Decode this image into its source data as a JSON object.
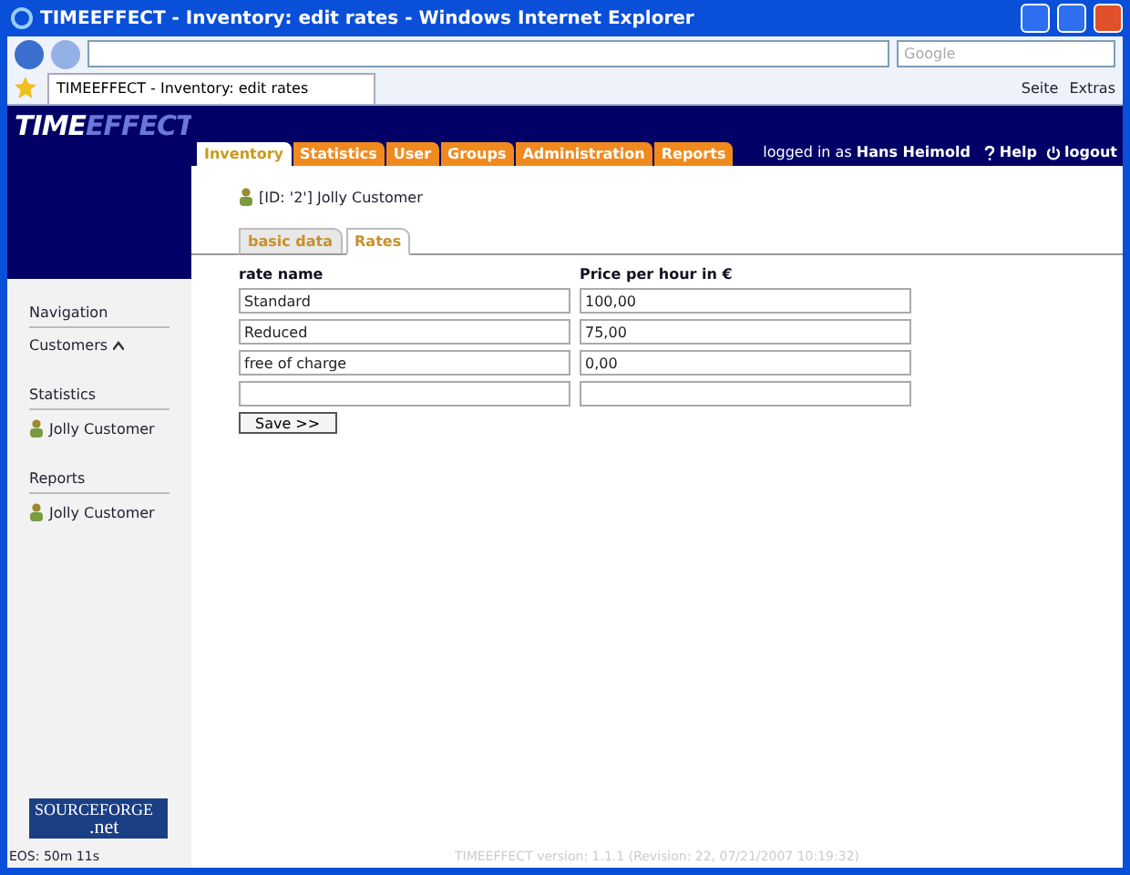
{
  "window": {
    "title": "TIMEEFFECT - Inventory: edit rates - Windows Internet Explorer"
  },
  "browser": {
    "search_placeholder": "Google",
    "tab_title": "TIMEEFFECT - Inventory: edit rates",
    "tools": [
      "Seite",
      "Extras"
    ]
  },
  "logo": {
    "first": "TIME",
    "second": "EFFECT"
  },
  "tabs": [
    {
      "label": "Inventory",
      "selected": true
    },
    {
      "label": "Statistics",
      "selected": false
    },
    {
      "label": "User",
      "selected": false
    },
    {
      "label": "Groups",
      "selected": false
    },
    {
      "label": "Administration",
      "selected": false
    },
    {
      "label": "Reports",
      "selected": false
    }
  ],
  "user": {
    "prefix": "logged in as",
    "name": "Hans Heimold"
  },
  "links": [
    "Help",
    "logout"
  ],
  "sidebar": [
    {
      "heading": "Navigation",
      "items": [
        {
          "label": "Customers",
          "kind": "nav"
        }
      ]
    },
    {
      "heading": "Statistics",
      "items": [
        {
          "label": "Jolly Customer",
          "kind": "customer"
        }
      ]
    },
    {
      "heading": "Reports",
      "items": [
        {
          "label": "Jolly Customer",
          "kind": "customer"
        }
      ]
    }
  ],
  "sourceforge": {
    "first": "SOURCEFORGE",
    "second": ".net"
  },
  "session": "EOS: 50m 11s",
  "record": "[ID: '2'] Jolly Customer",
  "subtabs": [
    {
      "label": "basic data",
      "selected": false
    },
    {
      "label": "Rates",
      "selected": true
    }
  ],
  "columns": [
    "rate name",
    "Price per hour in €"
  ],
  "rates": [
    {
      "kind": "filled",
      "name": "Standard",
      "price": "100,00"
    },
    {
      "kind": "filled",
      "name": "Reduced",
      "price": "75,00"
    },
    {
      "kind": "filled",
      "name": "free of charge",
      "price": "0,00"
    },
    {
      "kind": "blank"
    }
  ],
  "save": "Save >>",
  "version": "TIMEEFFECT version: 1.1.1 (Revision: 22, 07/21/2007 10:19:32)"
}
